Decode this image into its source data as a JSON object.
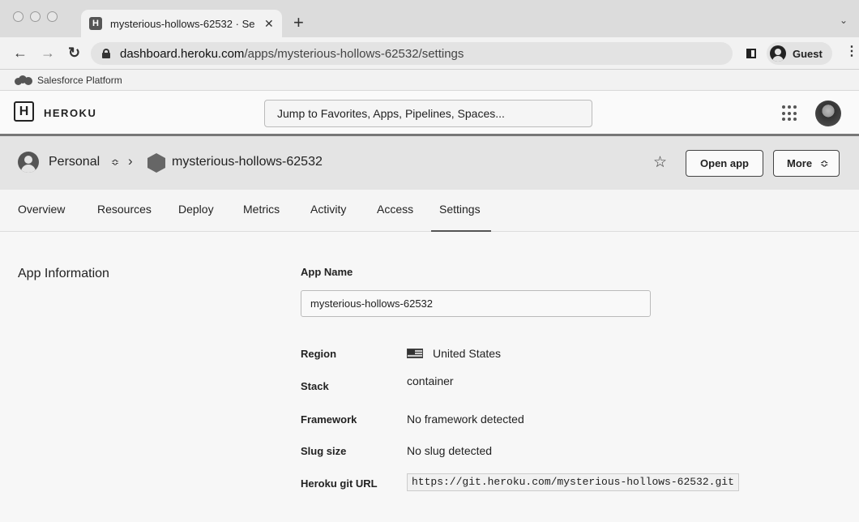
{
  "browser": {
    "tab_title": "mysterious-hollows-62532 · Se",
    "favicon_letter": "H",
    "url_host": "dashboard.heroku.com",
    "url_path": "/apps/mysterious-hollows-62532/settings",
    "profile_label": "Guest"
  },
  "bookmark_bar": {
    "label": "Salesforce Platform"
  },
  "header": {
    "logo_letter": "H",
    "brand": "HEROKU",
    "search_placeholder": "Jump to Favorites, Apps, Pipelines, Spaces..."
  },
  "appbar": {
    "account": "Personal",
    "app_name": "mysterious-hollows-62532",
    "open_app_label": "Open app",
    "more_label": "More"
  },
  "tabs": [
    {
      "label": "Overview",
      "active": false
    },
    {
      "label": "Resources",
      "active": false
    },
    {
      "label": "Deploy",
      "active": false
    },
    {
      "label": "Metrics",
      "active": false
    },
    {
      "label": "Activity",
      "active": false
    },
    {
      "label": "Access",
      "active": false
    },
    {
      "label": "Settings",
      "active": true
    }
  ],
  "settings": {
    "section_title": "App Information",
    "app_name_label": "App Name",
    "app_name_value": "mysterious-hollows-62532",
    "rows": [
      {
        "label": "Region",
        "value": "United States"
      },
      {
        "label": "Stack",
        "value": "container"
      },
      {
        "label": "Framework",
        "value": "No framework detected"
      },
      {
        "label": "Slug size",
        "value": "No slug detected"
      },
      {
        "label": "Heroku git URL",
        "value": "https://git.heroku.com/mysterious-hollows-62532.git"
      }
    ]
  }
}
